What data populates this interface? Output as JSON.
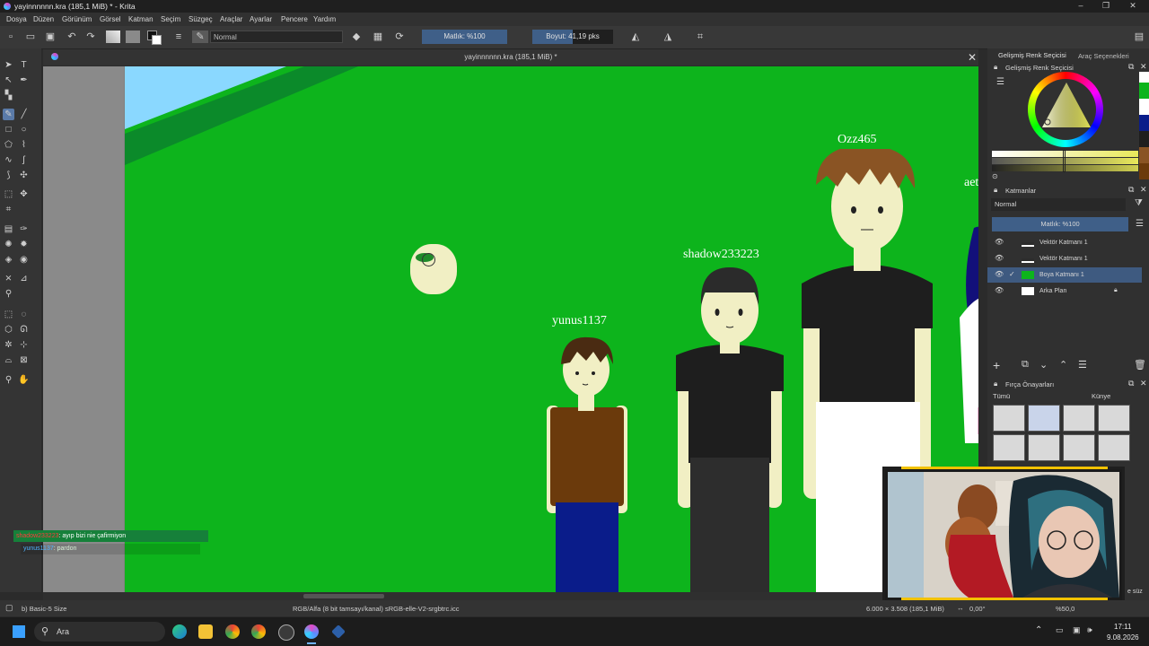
{
  "window": {
    "title": "yayinnnnnn.kra (185,1 MiB) * - Krita",
    "controls": [
      "–",
      "❐",
      "✕"
    ]
  },
  "menu": [
    "Dosya",
    "Düzen",
    "Görünüm",
    "Görsel",
    "Katman",
    "Seçim",
    "Süzgeç",
    "Araçlar",
    "Ayarlar",
    "Pencere",
    "Yardım"
  ],
  "toolbar": {
    "blend_mode": "Normal",
    "opacity_label": "Matlık: %100",
    "opacity_level": 1.0,
    "size_label": "Boyut: 41,19 pks",
    "size_level": 0.5
  },
  "document": {
    "tab_title": "yayinnnnnn.kra (185,1 MiB) *",
    "canvas_bg": "#0db41c",
    "names": [
      "Ozz465",
      "shadow233223",
      "yunus1137",
      "aet"
    ]
  },
  "chat": [
    {
      "user": "shadow233223",
      "user_color": "#ff3b3b",
      "text": ": ayıp bizi nie çafirmiyon"
    },
    {
      "user": "yunus1137",
      "user_color": "#4fb3ff",
      "text": ": pardon"
    }
  ],
  "right_dock": {
    "tab_color": "Gelişmiş Renk Seçicisi",
    "tab_tool": "Araç Seçenekleri",
    "color_panel_title": "Gelişmiş Renk Seçicisi",
    "layers_title": "Katmanlar",
    "layers_blend": "Normal",
    "layers_opacity": "Matlık: %100",
    "layers": [
      {
        "name": "Vektör Katmanı 1",
        "selected": false
      },
      {
        "name": "Vektör Katmanı 1",
        "selected": false
      },
      {
        "name": "Boya Katmanı 1",
        "selected": true
      },
      {
        "name": "Arka Plan",
        "selected": false
      }
    ],
    "brush_presets_title": "Fırça Önayarları",
    "brush_filter": "Tümü",
    "brush_tag": "Künye",
    "filter_text": "e süz"
  },
  "status": {
    "brush": "b) Basic-5 Size",
    "color_space": "RGB/Alfa (8 bit tamsayı/kanal) sRGB-elle-V2-srgbtrc.icc",
    "dimensions": "6.000 × 3.508 (185,1 MiB)",
    "rotation": "0,00°",
    "zoom": "%50,0"
  },
  "taskbar": {
    "search_placeholder": "Ara",
    "time": "17:11",
    "date": "9.08.2026"
  }
}
